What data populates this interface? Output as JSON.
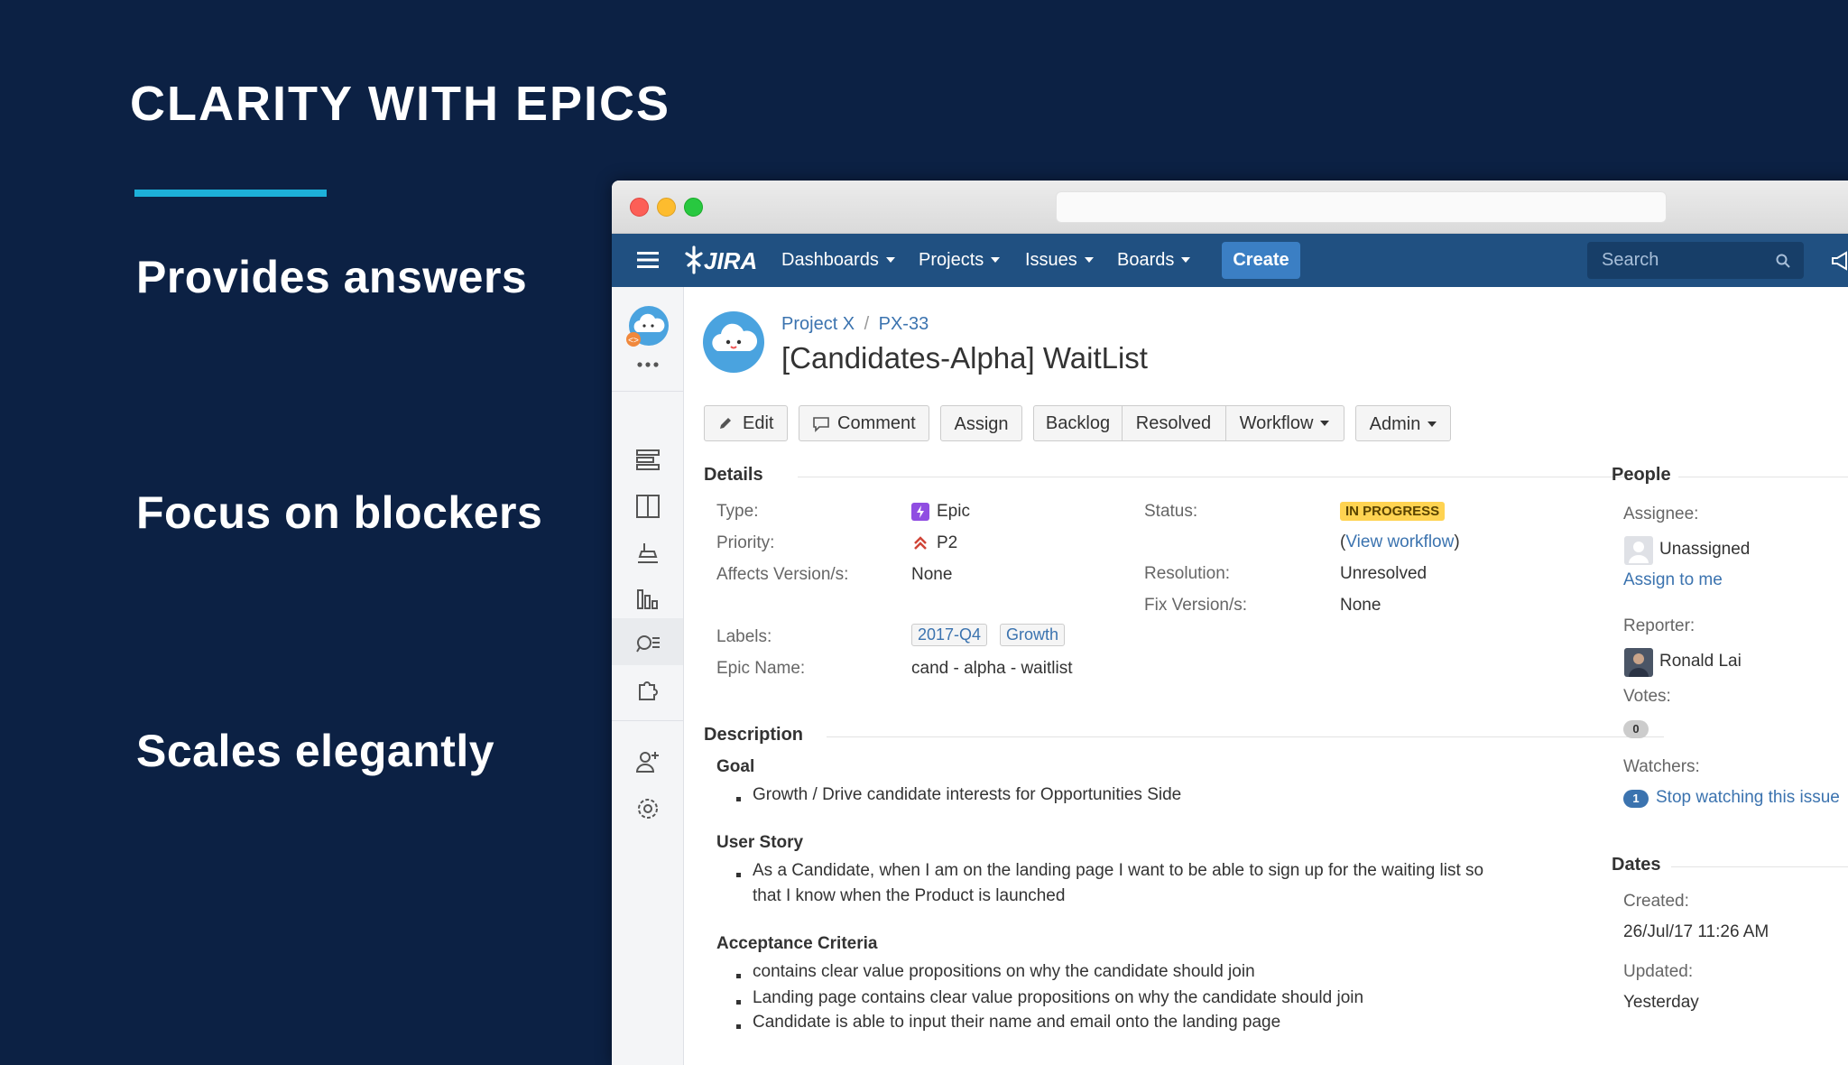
{
  "slide": {
    "title": "CLARITY WITH EPICS",
    "points": [
      "Provides answers",
      "Focus on blockers",
      "Scales elegantly"
    ],
    "accent_color": "#1db0d9"
  },
  "nav": {
    "logo": "JIRA",
    "items": [
      "Dashboards",
      "Projects",
      "Issues",
      "Boards"
    ],
    "create": "Create",
    "search_placeholder": "Search"
  },
  "issue": {
    "project": "Project X",
    "separator": "/",
    "key": "PX-33",
    "title": "[Candidates-Alpha] WaitList"
  },
  "toolbar": {
    "edit": "Edit",
    "comment": "Comment",
    "assign": "Assign",
    "backlog": "Backlog",
    "resolved": "Resolved",
    "workflow": "Workflow",
    "admin": "Admin"
  },
  "details": {
    "heading": "Details",
    "type_label": "Type:",
    "type_value": "Epic",
    "priority_label": "Priority:",
    "priority_value": "P2",
    "affects_label": "Affects Version/s:",
    "affects_value": "None",
    "labels_label": "Labels:",
    "labels": [
      "2017-Q4",
      "Growth"
    ],
    "epic_name_label": "Epic Name:",
    "epic_name_value": "cand - alpha - waitlist",
    "status_label": "Status:",
    "status_value": "IN PROGRESS",
    "view_workflow_open": "(",
    "view_workflow": "View workflow",
    "view_workflow_close": ")",
    "resolution_label": "Resolution:",
    "resolution_value": "Unresolved",
    "fix_label": "Fix Version/s:",
    "fix_value": "None"
  },
  "description": {
    "heading": "Description",
    "goal_heading": "Goal",
    "goal_items": [
      "Growth / Drive candidate interests for Opportunities Side"
    ],
    "story_heading": "User Story",
    "story_line1": "As a Candidate, when I am on the landing page I want to be able to sign up for the waiting list so",
    "story_line2": "that I know when the Product is launched",
    "criteria_heading": "Acceptance Criteria",
    "criteria_items": [
      "contains clear value propositions on why the candidate should join",
      "Landing page contains clear value propositions on why the candidate should join",
      "Candidate is able to input their name and email onto the landing page"
    ]
  },
  "people": {
    "heading": "People",
    "assignee_label": "Assignee:",
    "assignee_value": "Unassigned",
    "assign_to_me": "Assign to me",
    "reporter_label": "Reporter:",
    "reporter_value": "Ronald Lai",
    "votes_label": "Votes:",
    "votes_count": "0",
    "watchers_label": "Watchers:",
    "watchers_count": "1",
    "stop_watching": "Stop watching this issue"
  },
  "dates": {
    "heading": "Dates",
    "created_label": "Created:",
    "created_value": "26/Jul/17 11:26 AM",
    "updated_label": "Updated:",
    "updated_value": "Yesterday"
  },
  "colors": {
    "navbar": "#205081",
    "create_button": "#3b7fc4",
    "link": "#3b73af",
    "status_lozenge": "#ffd351",
    "epic_icon": "#904ee2",
    "priority_icon": "#d04437"
  }
}
